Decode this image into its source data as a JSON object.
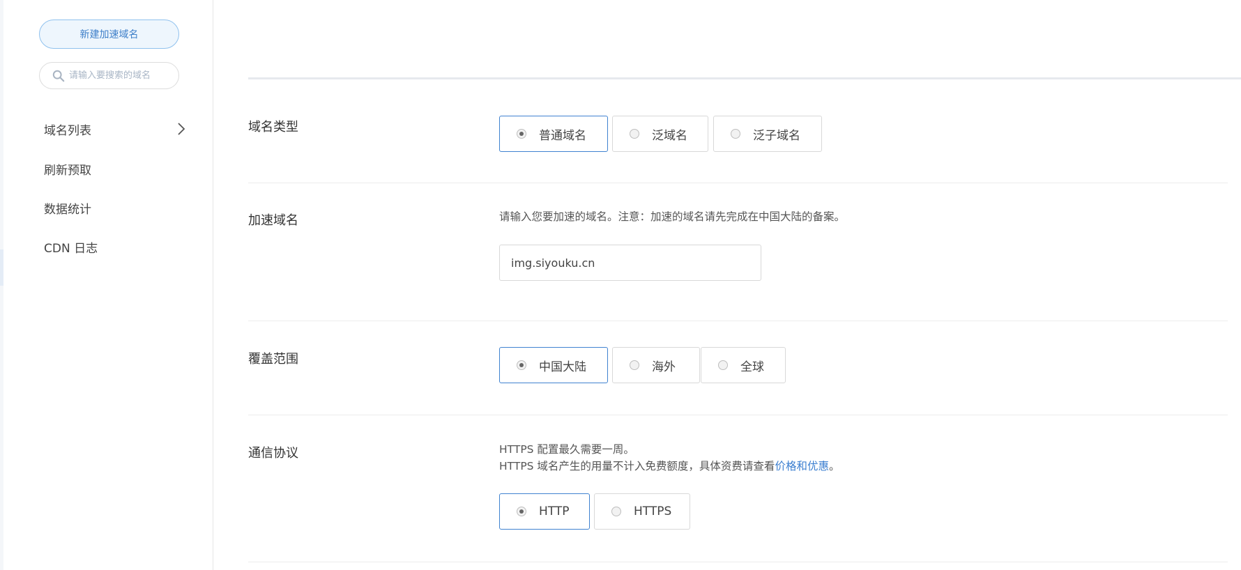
{
  "sidebar": {
    "new_button": "新建加速域名",
    "search_placeholder": "请输入要搜索的域名",
    "nav": {
      "domain_list": "域名列表",
      "refresh": "刷新预取",
      "stats": "数据统计",
      "logs": "CDN 日志"
    }
  },
  "form": {
    "domain_type": {
      "label": "域名类型",
      "options": [
        "普通域名",
        "泛域名",
        "泛子域名"
      ],
      "selected": "普通域名"
    },
    "accel_domain": {
      "label": "加速域名",
      "hint": "请输入您要加速的域名。注意：加速的域名请先完成在中国大陆的备案。",
      "value": "img.siyouku.cn"
    },
    "coverage": {
      "label": "覆盖范围",
      "options": [
        "中国大陆",
        "海外",
        "全球"
      ],
      "selected": "中国大陆"
    },
    "protocol": {
      "label": "通信协议",
      "hint_line1": "HTTPS 配置最久需要一周。",
      "hint_line2_prefix": "HTTPS 域名产生的用量不计入免费额度，具体资费请查看",
      "hint_link": "价格和优惠",
      "hint_line2_suffix": "。",
      "options": [
        "HTTP",
        "HTTPS"
      ],
      "selected": "HTTP"
    }
  },
  "colors": {
    "accent": "#3f82d0",
    "new_button_bg": "#eef6fd",
    "link": "#3c7fd0"
  },
  "icons": {
    "search": "search-icon",
    "chevron": "chevron-right-icon"
  }
}
